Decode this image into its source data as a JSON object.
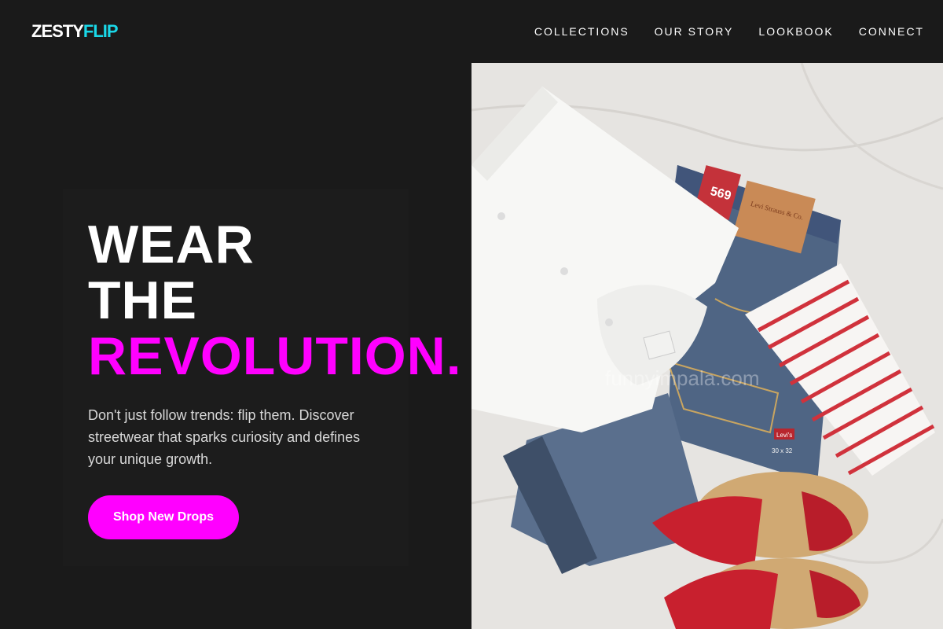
{
  "nav": {
    "logo_part1": "ZESTY",
    "logo_part2": "FLIP",
    "items": [
      {
        "label": "COLLECTIONS"
      },
      {
        "label": "OUR STORY"
      },
      {
        "label": "LOOKBOOK"
      },
      {
        "label": "CONNECT"
      }
    ]
  },
  "hero": {
    "line1": "WEAR",
    "line2": "THE",
    "line3": "REVOLUTION.",
    "description": "Don't just follow trends: flip them. Discover streetwear that sparks curiosity and defines your unique growth.",
    "cta_label": "Shop New Drops"
  },
  "photo": {
    "label_size": "569",
    "leather_tag": "Levi Strauss & Co.",
    "watermark": "funnyimpala.com",
    "pocket_tag": "Levi's",
    "size_text": "30 x 32"
  },
  "colors": {
    "background": "#1a1a1a",
    "accent": "#ff00ff",
    "logo_accent": "#1ad8e8"
  }
}
